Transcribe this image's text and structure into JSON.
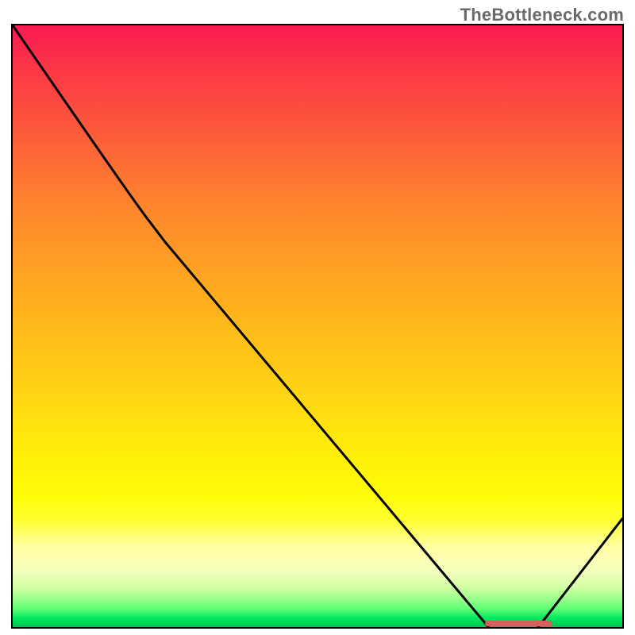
{
  "watermark": "TheBottleneck.com",
  "chart_data": {
    "type": "line",
    "title": "",
    "xlabel": "",
    "ylabel": "",
    "xlim": [
      0,
      100
    ],
    "ylim": [
      0,
      100
    ],
    "grid": false,
    "legend": false,
    "series": [
      {
        "name": "curve",
        "points": [
          [
            0,
            100
          ],
          [
            19,
            72
          ],
          [
            25,
            64
          ],
          [
            80,
            0
          ],
          [
            85,
            0.2
          ],
          [
            100,
            18
          ]
        ]
      }
    ],
    "marker": {
      "x_start": 77.5,
      "x_end": 88.5,
      "y": 0.6
    },
    "background": "red-yellow-green vertical gradient"
  }
}
